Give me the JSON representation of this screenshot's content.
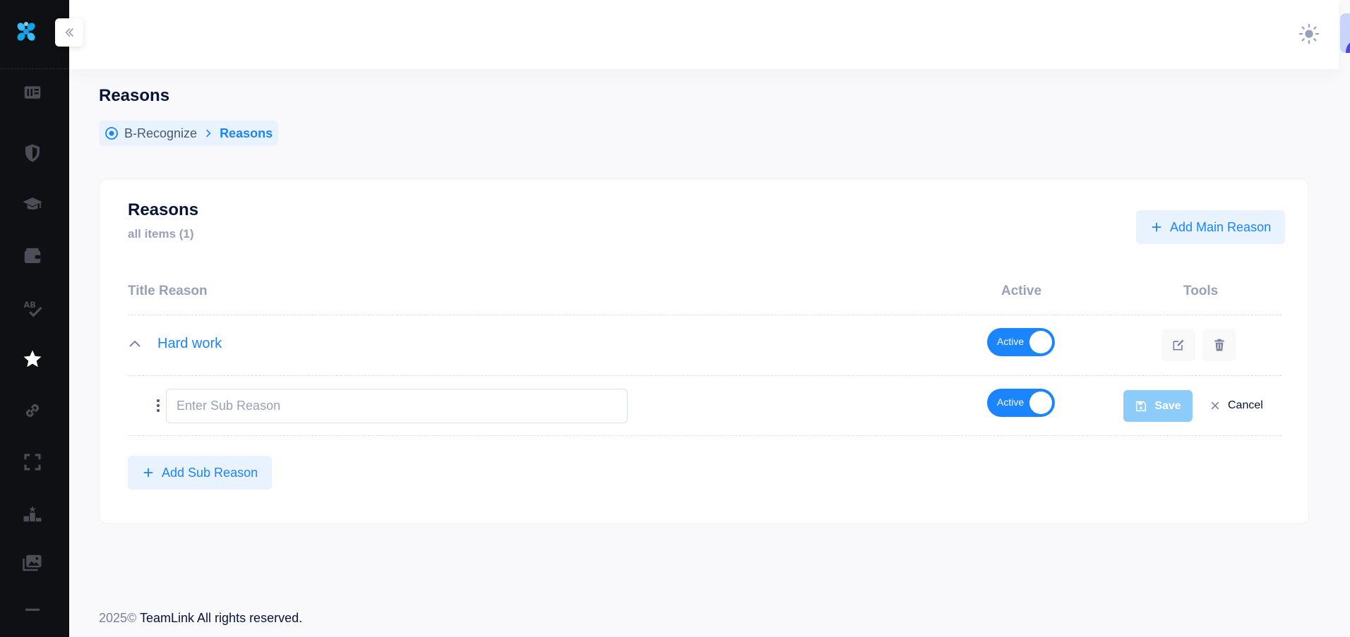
{
  "colors": {
    "sidebar_bg": "#0f1014",
    "accent": "#1b84ff",
    "accent_light": "#e9f3ff",
    "save_disabled": "#8ccbfa"
  },
  "sidebar": {
    "logo_icon": "flower-logo",
    "items": [
      {
        "icon": "news-icon",
        "active": false
      },
      {
        "icon": "shield-icon",
        "active": false
      },
      {
        "icon": "graduation-cap-icon",
        "active": false
      },
      {
        "icon": "wallet-icon",
        "active": false
      },
      {
        "icon": "spell-check-icon",
        "active": false
      },
      {
        "icon": "star-icon",
        "active": true
      },
      {
        "icon": "link-icon",
        "active": false
      },
      {
        "icon": "scan-frame-icon",
        "active": false
      },
      {
        "icon": "podium-icon",
        "active": false
      },
      {
        "icon": "gallery-icon",
        "active": false
      },
      {
        "icon": "minus-icon",
        "active": false
      }
    ]
  },
  "header": {
    "theme_icon": "sun-icon",
    "avatar_icon": "user-avatar"
  },
  "page": {
    "title": "Reasons",
    "breadcrumb": {
      "home": "B-Recognize",
      "current": "Reasons"
    }
  },
  "card": {
    "title": "Reasons",
    "subtitle": "all items (1)",
    "add_main_label": "Add Main Reason",
    "columns": {
      "title": "Title Reason",
      "active": "Active",
      "tools": "Tools"
    },
    "reasons": [
      {
        "title": "Hard work",
        "status_label": "Active",
        "active": true
      }
    ],
    "sub_reason_form": {
      "placeholder": "Enter Sub Reason",
      "value": "",
      "status_label": "Active",
      "active": true,
      "save_label": "Save",
      "cancel_label": "Cancel"
    },
    "add_sub_label": "Add Sub Reason"
  },
  "footer": {
    "year": "2025©",
    "text": "TeamLink All rights reserved."
  }
}
